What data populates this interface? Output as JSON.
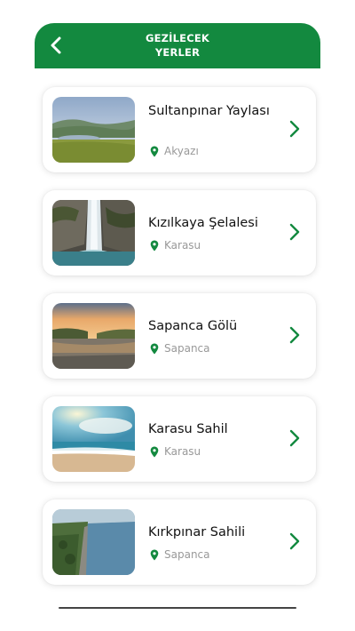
{
  "header": {
    "title_line1": "GEZİLECEK",
    "title_line2": "YERLER",
    "back_icon": "chevron-left-icon",
    "background": "#13893f"
  },
  "accent_color": "#13893f",
  "places": [
    {
      "title": "Sultanpınar Yaylası",
      "location": "Akyazı",
      "image": "mountain-plateau-lake"
    },
    {
      "title": "Kızılkaya Şelalesi",
      "location": "Karasu",
      "image": "waterfall"
    },
    {
      "title": "Sapanca Gölü",
      "location": "Sapanca",
      "image": "lake-sunset"
    },
    {
      "title": "Karasu Sahil",
      "location": "Karasu",
      "image": "beach"
    },
    {
      "title": "Kırkpınar Sahili",
      "location": "Sapanca",
      "image": "lakeshore-aerial"
    }
  ],
  "icons": {
    "location": "map-pin-icon",
    "open": "chevron-right-icon"
  }
}
